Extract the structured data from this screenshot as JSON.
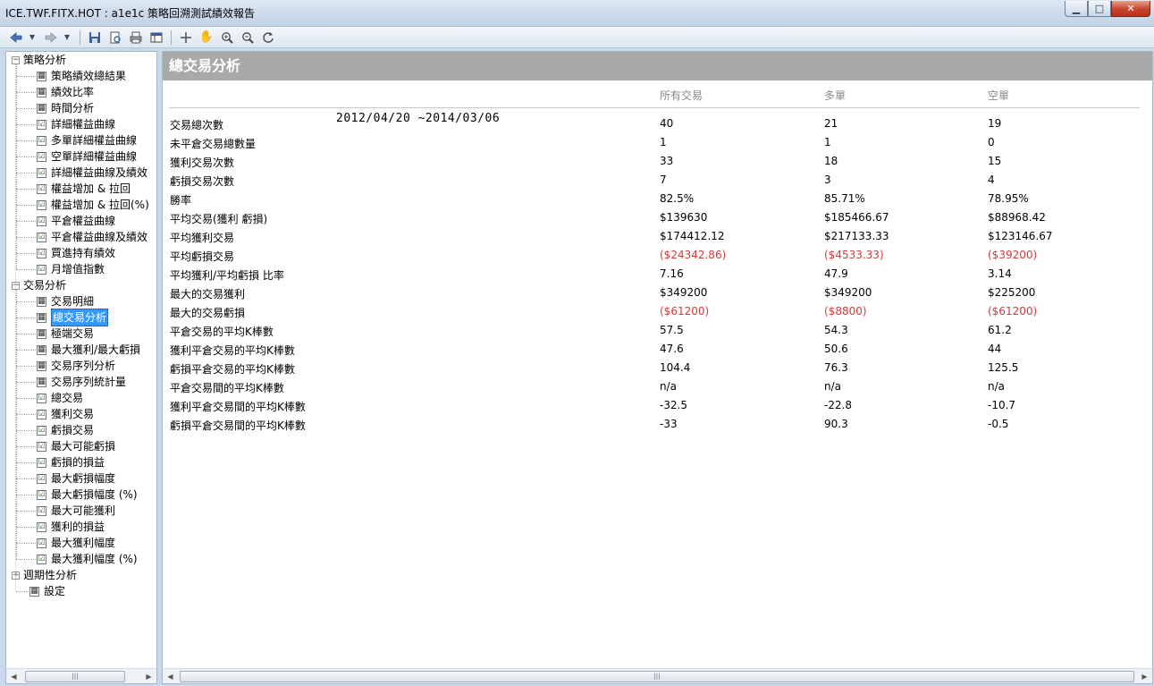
{
  "window": {
    "title": "ICE.TWF.FITX.HOT : a1e1c 策略回溯測試績效報告",
    "min_glyph": "▁",
    "max_glyph": "□",
    "close_glyph": "✕"
  },
  "toolbar": {
    "icons": [
      "back-arrow",
      "dropdown",
      "forward-arrow",
      "dropdown",
      "save",
      "print-preview",
      "print",
      "layout",
      "crosshair",
      "hand",
      "zoom-in",
      "zoom-out",
      "refresh"
    ]
  },
  "tree": {
    "groups": [
      {
        "label": "策略分析",
        "items": [
          {
            "label": "策略績效總結果",
            "icon": "grid"
          },
          {
            "label": "績效比率",
            "icon": "grid"
          },
          {
            "label": "時間分析",
            "icon": "grid"
          },
          {
            "label": "詳細權益曲線",
            "icon": "chart"
          },
          {
            "label": "多單詳細權益曲線",
            "icon": "chart"
          },
          {
            "label": "空單詳細權益曲線",
            "icon": "chart"
          },
          {
            "label": "詳細權益曲線及績效",
            "icon": "chart"
          },
          {
            "label": "權益增加 & 拉回",
            "icon": "chart"
          },
          {
            "label": "權益增加 & 拉回(%)",
            "icon": "chart"
          },
          {
            "label": "平倉權益曲線",
            "icon": "chart"
          },
          {
            "label": "平倉權益曲線及績效",
            "icon": "chart"
          },
          {
            "label": "買進持有績效",
            "icon": "chart"
          },
          {
            "label": "月增值指數",
            "icon": "chart"
          }
        ]
      },
      {
        "label": "交易分析",
        "items": [
          {
            "label": "交易明細",
            "icon": "grid"
          },
          {
            "label": "總交易分析",
            "icon": "grid",
            "selected": true
          },
          {
            "label": "極端交易",
            "icon": "grid"
          },
          {
            "label": "最大獲利/最大虧損",
            "icon": "grid"
          },
          {
            "label": "交易序列分析",
            "icon": "grid"
          },
          {
            "label": "交易序列統計量",
            "icon": "grid"
          },
          {
            "label": "總交易",
            "icon": "chart"
          },
          {
            "label": "獲利交易",
            "icon": "chart"
          },
          {
            "label": "虧損交易",
            "icon": "chart"
          },
          {
            "label": "最大可能虧損",
            "icon": "chart"
          },
          {
            "label": "虧損的損益",
            "icon": "chart"
          },
          {
            "label": "最大虧損幅度",
            "icon": "chart"
          },
          {
            "label": "最大虧損幅度 (%)",
            "icon": "chart"
          },
          {
            "label": "最大可能獲利",
            "icon": "chart"
          },
          {
            "label": "獲利的損益",
            "icon": "chart"
          },
          {
            "label": "最大獲利幅度",
            "icon": "chart"
          },
          {
            "label": "最大獲利幅度 (%)",
            "icon": "chart"
          }
        ]
      },
      {
        "label": "週期性分析",
        "items": []
      }
    ],
    "settings_label": "設定"
  },
  "report": {
    "title": "總交易分析",
    "date_range": "2012/04/20 ~2014/03/06",
    "columns": [
      "所有交易",
      "多單",
      "空單"
    ],
    "rows": [
      {
        "label": "交易總次數",
        "values": [
          "40",
          "21",
          "19"
        ],
        "neg": [
          false,
          false,
          false
        ]
      },
      {
        "label": "未平倉交易總數量",
        "values": [
          "1",
          "1",
          "0"
        ],
        "neg": [
          false,
          false,
          false
        ]
      },
      {
        "label": "獲利交易次數",
        "values": [
          "33",
          "18",
          "15"
        ],
        "neg": [
          false,
          false,
          false
        ]
      },
      {
        "label": "虧損交易次數",
        "values": [
          "7",
          "3",
          "4"
        ],
        "neg": [
          false,
          false,
          false
        ]
      },
      {
        "label": "勝率",
        "values": [
          "82.5%",
          "85.71%",
          "78.95%"
        ],
        "neg": [
          false,
          false,
          false
        ]
      },
      {
        "label": "平均交易(獲利 虧損)",
        "values": [
          "$139630",
          "$185466.67",
          "$88968.42"
        ],
        "neg": [
          false,
          false,
          false
        ]
      },
      {
        "label": "平均獲利交易",
        "values": [
          "$174412.12",
          "$217133.33",
          "$123146.67"
        ],
        "neg": [
          false,
          false,
          false
        ]
      },
      {
        "label": "平均虧損交易",
        "values": [
          "($24342.86)",
          "($4533.33)",
          "($39200)"
        ],
        "neg": [
          true,
          true,
          true
        ]
      },
      {
        "label": "平均獲利/平均虧損 比率",
        "values": [
          "7.16",
          "47.9",
          "3.14"
        ],
        "neg": [
          false,
          false,
          false
        ]
      },
      {
        "label": "最大的交易獲利",
        "values": [
          "$349200",
          "$349200",
          "$225200"
        ],
        "neg": [
          false,
          false,
          false
        ]
      },
      {
        "label": "最大的交易虧損",
        "values": [
          "($61200)",
          "($8800)",
          "($61200)"
        ],
        "neg": [
          true,
          true,
          true
        ]
      },
      {
        "label": "平倉交易的平均K棒數",
        "values": [
          "57.5",
          "54.3",
          "61.2"
        ],
        "neg": [
          false,
          false,
          false
        ]
      },
      {
        "label": "獲利平倉交易的平均K棒數",
        "values": [
          "47.6",
          "50.6",
          "44"
        ],
        "neg": [
          false,
          false,
          false
        ]
      },
      {
        "label": "虧損平倉交易的平均K棒數",
        "values": [
          "104.4",
          "76.3",
          "125.5"
        ],
        "neg": [
          false,
          false,
          false
        ]
      },
      {
        "label": "平倉交易間的平均K棒數",
        "values": [
          "n/a",
          "n/a",
          "n/a"
        ],
        "neg": [
          false,
          false,
          false
        ]
      },
      {
        "label": "獲利平倉交易間的平均K棒數",
        "values": [
          "-32.5",
          "-22.8",
          "-10.7"
        ],
        "neg": [
          false,
          false,
          false
        ]
      },
      {
        "label": "虧損平倉交易間的平均K棒數",
        "values": [
          "-33",
          "90.3",
          "-0.5"
        ],
        "neg": [
          false,
          false,
          false
        ]
      }
    ]
  },
  "colors": {
    "header_bg": "#a9a9a9",
    "negative": "#d43a3a",
    "selection": "#3399ff"
  }
}
